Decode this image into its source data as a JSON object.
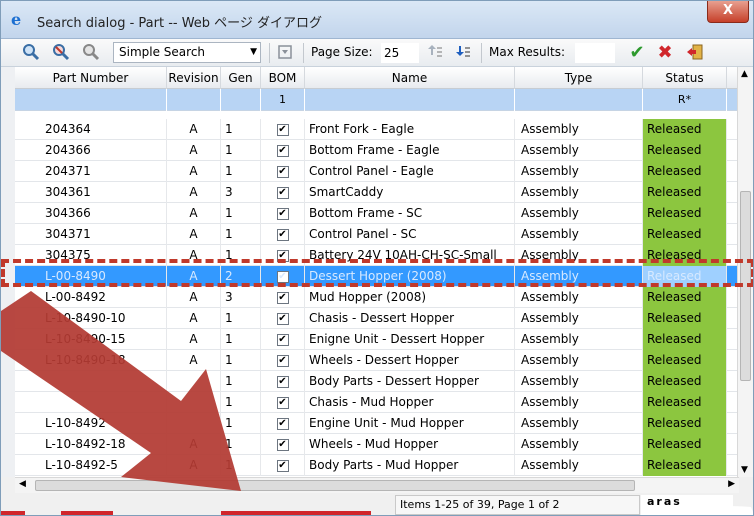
{
  "window": {
    "title": "Search dialog - Part -- Web ページ ダイアログ",
    "close_label": "X"
  },
  "toolbar": {
    "search_mode": "Simple Search",
    "page_size_label": "Page Size:",
    "page_size_value": "25",
    "max_results_label": "Max Results:",
    "max_results_value": ""
  },
  "columns": [
    "Part Number",
    "Revision",
    "Gen",
    "BOM",
    "Name",
    "Type",
    "Status"
  ],
  "filter": {
    "bom": "1",
    "status": "R*"
  },
  "rows": [
    {
      "part": "204364",
      "rev": "A",
      "gen": "1",
      "bom": "✔",
      "name": "Front Fork - Eagle",
      "type": "Assembly",
      "status": "Released"
    },
    {
      "part": "204366",
      "rev": "A",
      "gen": "1",
      "bom": "✔",
      "name": "Bottom Frame - Eagle",
      "type": "Assembly",
      "status": "Released"
    },
    {
      "part": "204371",
      "rev": "A",
      "gen": "1",
      "bom": "✔",
      "name": "Control Panel - Eagle",
      "type": "Assembly",
      "status": "Released"
    },
    {
      "part": "304361",
      "rev": "A",
      "gen": "3",
      "bom": "✔",
      "name": "SmartCaddy",
      "type": "Assembly",
      "status": "Released"
    },
    {
      "part": "304366",
      "rev": "A",
      "gen": "1",
      "bom": "✔",
      "name": "Bottom Frame - SC",
      "type": "Assembly",
      "status": "Released"
    },
    {
      "part": "304371",
      "rev": "A",
      "gen": "1",
      "bom": "✔",
      "name": "Control Panel - SC",
      "type": "Assembly",
      "status": "Released"
    },
    {
      "part": "304375",
      "rev": "A",
      "gen": "1",
      "bom": "✔",
      "name": "Battery 24V 10AH-CH-SC-Small",
      "type": "Assembly",
      "status": "Released"
    },
    {
      "part": "L-00-8490",
      "rev": "A",
      "gen": "2",
      "bom": "✔",
      "name": "Dessert Hopper (2008)",
      "type": "Assembly",
      "status": "Released",
      "selected": true
    },
    {
      "part": "L-00-8492",
      "rev": "A",
      "gen": "3",
      "bom": "✔",
      "name": "Mud Hopper (2008)",
      "type": "Assembly",
      "status": "Released"
    },
    {
      "part": "L-10-8490-10",
      "rev": "A",
      "gen": "1",
      "bom": "✔",
      "name": "Chasis - Dessert Hopper",
      "type": "Assembly",
      "status": "Released"
    },
    {
      "part": "L-10-8490-15",
      "rev": "A",
      "gen": "1",
      "bom": "✔",
      "name": "Enigne Unit - Dessert Hopper",
      "type": "Assembly",
      "status": "Released"
    },
    {
      "part": "L-10-8490-18",
      "rev": "A",
      "gen": "1",
      "bom": "✔",
      "name": "Wheels - Dessert Hopper",
      "type": "Assembly",
      "status": "Released"
    },
    {
      "part": "",
      "rev": "",
      "gen": "1",
      "bom": "✔",
      "name": "Body Parts - Dessert Hopper",
      "type": "Assembly",
      "status": "Released"
    },
    {
      "part": "",
      "rev": "",
      "gen": "1",
      "bom": "✔",
      "name": "Chasis - Mud Hopper",
      "type": "Assembly",
      "status": "Released"
    },
    {
      "part": "L-10-8492",
      "rev": "",
      "gen": "1",
      "bom": "✔",
      "name": "Engine Unit - Mud Hopper",
      "type": "Assembly",
      "status": "Released"
    },
    {
      "part": "L-10-8492-18",
      "rev": "A",
      "gen": "1",
      "bom": "✔",
      "name": "Wheels - Mud Hopper",
      "type": "Assembly",
      "status": "Released"
    },
    {
      "part": "L-10-8492-5",
      "rev": "A",
      "gen": "1",
      "bom": "✔",
      "name": "Body Parts - Mud Hopper",
      "type": "Assembly",
      "status": "Released"
    }
  ],
  "statusbar": {
    "items_text": "Items 1-25 of 39, Page 1 of 2",
    "brand": "aras"
  },
  "colors": {
    "released": "#8cc63f",
    "selected_row": "#3399ff",
    "annotation": "#c0392b"
  }
}
